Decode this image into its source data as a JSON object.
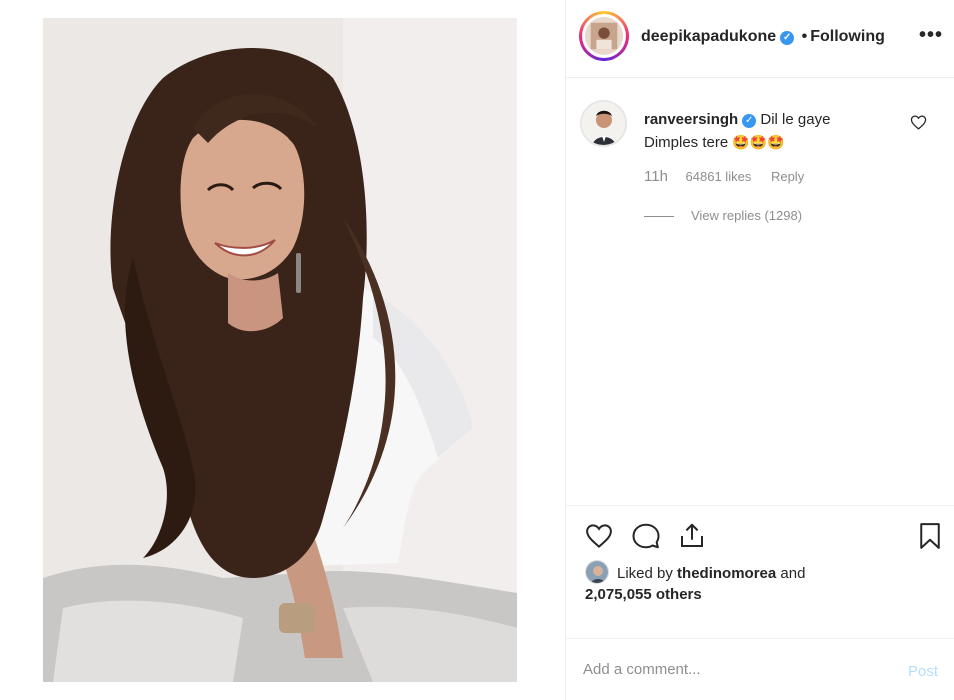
{
  "post": {
    "owner": "deepikapadukone",
    "separator": "•",
    "follow_state": "Following",
    "more_label": "•••"
  },
  "comment": {
    "user": "ranveersingh",
    "text_line1": "Dil le gaye",
    "text_line2": "Dimples tere",
    "emojis": "🤩🤩🤩",
    "time": "11h",
    "likes": "64861 likes",
    "reply_label": "Reply",
    "view_replies": "View replies (1298)"
  },
  "actions": {
    "like_icon": "heart-icon",
    "comment_icon": "comment-icon",
    "share_icon": "share-icon",
    "save_icon": "bookmark-icon"
  },
  "liked_by": {
    "prefix": "Liked by",
    "user": "thedinomorea",
    "and": "and",
    "others": "2,075,055 others"
  },
  "add_comment": {
    "placeholder": "Add a comment...",
    "post_label": "Post"
  },
  "colors": {
    "verified": "#3897f0",
    "post_disabled": "#b2dffc",
    "muted_text": "#8e8e8e"
  }
}
